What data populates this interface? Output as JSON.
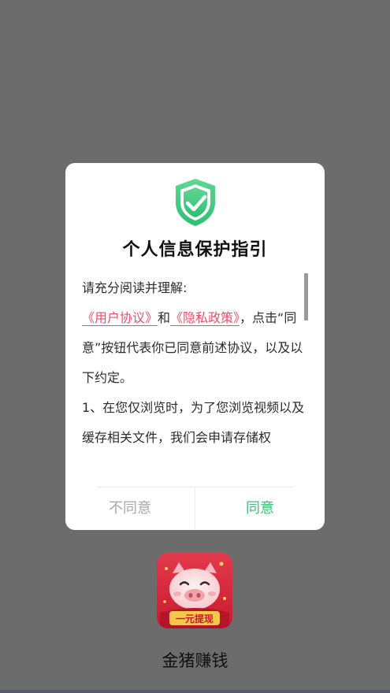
{
  "dialog": {
    "title": "个人信息保护指引",
    "intro": "请充分阅读并理解:",
    "user_agreement_link": "《用户协议》",
    "and_text": "和",
    "privacy_policy_link": "《隐私政策》",
    "consent_text": "，点击“同意”按钮代表你已同意前述协议，以及以下约定。",
    "item_1": "1、在您仅浏览时，为了您浏览视频以及缓存相关文件，我们会申请存储权",
    "disagree_label": "不同意",
    "agree_label": "同意"
  },
  "app": {
    "name": "金猪赚钱",
    "icon_banner_text": "一元提现"
  },
  "icons": {
    "shield": "shield-check-icon",
    "app": "pig-app-icon"
  },
  "colors": {
    "accent_green": "#3ec07a",
    "link_red": "#ee4c66",
    "scrim": "#6c6c6c",
    "app_icon_red": "#d8223a"
  }
}
